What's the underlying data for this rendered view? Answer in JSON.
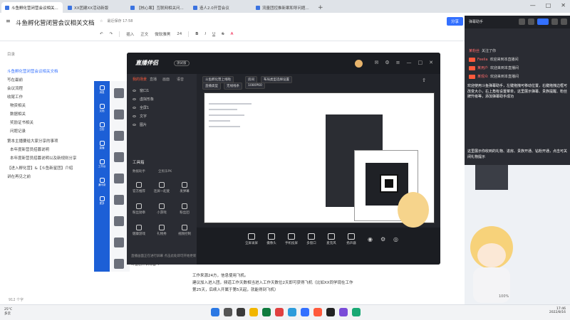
{
  "browser": {
    "tabs": [
      {
        "label": "斗鱼孵化营闭营会议相关..."
      },
      {
        "label": "XX团建XX活动新版"
      },
      {
        "label": "【核心案】互联网相关问..."
      },
      {
        "label": "造人2.0开营会议"
      },
      {
        "label": "流量团控推新案和导问题..."
      }
    ],
    "new_tab": "+"
  },
  "doc": {
    "title": "斗鱼孵化营闭营会议相关文档",
    "saved_meta": "最近保存 17:58",
    "share_label": "分享",
    "toolbar": [
      "插入",
      "正文",
      "微软雅黑",
      "24",
      "B",
      "I",
      "U",
      "S",
      "A"
    ],
    "outline_title": "目录",
    "outline": [
      {
        "label": "斗鱼孵化营闭营会议相关文档",
        "active": true
      },
      {
        "label": "写在最前"
      },
      {
        "label": "会议流程"
      },
      {
        "label": "收尾工作"
      },
      {
        "label": "物资相关",
        "sub": true
      },
      {
        "label": "数据相关",
        "sub": true
      },
      {
        "label": "奖励证书相关",
        "sub": true
      },
      {
        "label": "问题记录",
        "sub": true
      },
      {
        "label": "第本主播要给大家分享的事项"
      },
      {
        "label": "本年度新营员招募说明",
        "sub": true
      },
      {
        "label": "本年度新营员招募说明以及新规则分享",
        "sub": true
      },
      {
        "label": "【进入孵化营】&【斗鱼新星团】介绍"
      },
      {
        "label": "讲在再见之前"
      }
    ],
    "body_text": [
      "工作来源24方，信息使用飞机。",
      "建议加入进入团，频道工作天数相当进入工作天数位2天即可获得飞机（比如XX同学现在工作",
      "第25天，后续入开属于第5天起，就能得到飞机）"
    ],
    "status_left": "912 个字",
    "zoom": "100%"
  },
  "appstrip": {
    "items": [
      {
        "label": "消息"
      },
      {
        "label": "文档"
      },
      {
        "label": "日历"
      },
      {
        "label": "直播"
      },
      {
        "label": "工作台"
      },
      {
        "label": "通讯录"
      },
      {
        "label": "更多"
      }
    ]
  },
  "thumb_label": "斗鱼创作训练营\"T\"",
  "stream": {
    "logo": "直播伴侣",
    "version": "测试版",
    "left_tabs": [
      "我的场景",
      "直播",
      "画面",
      "语音"
    ],
    "layers": [
      {
        "label": "窗口1"
      },
      {
        "label": "虚拟形象"
      },
      {
        "label": "全屏1"
      },
      {
        "label": "文字"
      },
      {
        "label": "图片"
      }
    ],
    "tools_title": "工具箱",
    "tools_sub": [
      "数据助手",
      "全民乐PK"
    ],
    "tools": [
      {
        "label": "官方推荐"
      },
      {
        "label": "连屏一起麦"
      },
      {
        "label": "发弹幕"
      },
      {
        "label": "粉丝勋章"
      },
      {
        "label": "小游戏"
      },
      {
        "label": "粉丝团"
      },
      {
        "label": "健康游戏"
      },
      {
        "label": "礼物秀"
      },
      {
        "label": "视频控制"
      }
    ],
    "left_note": "直播画面正在进行屏幕 点击此处即可开始更新",
    "preview_chips": [
      "斗鱼孵化营上线啦",
      "房间",
      "布局类型选择设置"
    ],
    "preview_chips2": [
      "直播类型",
      "无线线条",
      "1080P60"
    ],
    "bottom": [
      {
        "label": "全屏录屏"
      },
      {
        "label": "摄像头"
      },
      {
        "label": "手机投屏"
      },
      {
        "label": "多窗口"
      },
      {
        "label": "麦克风"
      },
      {
        "label": "扬声器"
      }
    ]
  },
  "chat": {
    "title": "弹幕助手",
    "live_label": "直播",
    "messages": [
      {
        "user": "某粉丝",
        "text": "关注了你"
      },
      {
        "user": "Feelia",
        "text": "欢迎来到本直播间"
      },
      {
        "user": "某用户",
        "text": "欢迎来到本直播间"
      },
      {
        "user": "某观众",
        "text": "欢迎来到本直播间"
      }
    ],
    "info1": "欢迎使用斗鱼弹幕助手，左键拖拽可移动位置，右键拖拽边框可改变大小，右上角有设置菜单，这里展示弹幕、贵族提醒、粉丝牌升级等，添加弹幕助手成功",
    "info2": "这里展示你收到的礼物、进房、贵族开通、钻粉开通，点击可关闭礼物提示"
  },
  "taskbar": {
    "temp": "25°C",
    "weather": "多云",
    "time": "17:46",
    "date": "2022/8/16"
  },
  "colors": {
    "accent": "#3370ff",
    "stream_orange": "#ff5a3c",
    "stream_dark": "#23252b"
  }
}
